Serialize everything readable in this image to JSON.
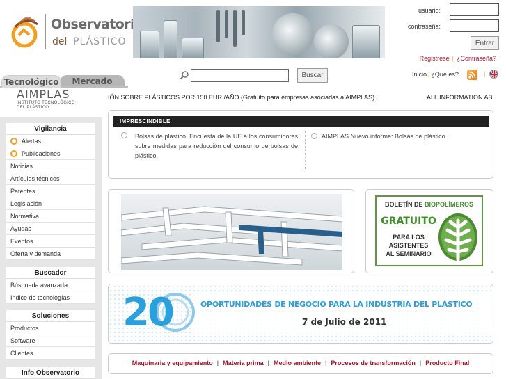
{
  "header": {
    "logo_title": "Observatorio",
    "logo_sub_del": "del",
    "logo_sub_plastico": "PLÁSTICO"
  },
  "login": {
    "user_label": "usuario:",
    "password_label": "contraseña:",
    "submit_label": "Entrar",
    "register_link": "Registrese",
    "separator": "|",
    "forgot_link": "¿Contraseña?"
  },
  "nav": {
    "tabs": [
      {
        "label": "Tecnológico"
      },
      {
        "label": "Mercado"
      }
    ],
    "search_button": "Buscar",
    "links": {
      "home": "Inicio",
      "about": "¿Qué es?",
      "separator": "|"
    }
  },
  "org": {
    "name": "AIMPLAS",
    "subtitle_line1": "INSTITUTO TECNOLÓGICO",
    "subtitle_line2": "DEL PLÁSTICO"
  },
  "sidebar": {
    "vigilancia": {
      "title": "Vigilancia",
      "items": [
        {
          "label": "Alertas"
        },
        {
          "label": "Publicaciones"
        },
        {
          "label": "Noticias"
        },
        {
          "label": "Artículos técnicos"
        },
        {
          "label": "Patentes"
        },
        {
          "label": "Legislación"
        },
        {
          "label": "Normativa"
        },
        {
          "label": "Ayudas"
        },
        {
          "label": "Eventos"
        },
        {
          "label": "Oferta y demanda"
        }
      ]
    },
    "buscador": {
      "title": "Buscador",
      "items": [
        {
          "label": "Búsqueda avanzada"
        },
        {
          "label": "Indice de tecnologías"
        }
      ]
    },
    "soluciones": {
      "title": "Soluciones",
      "items": [
        {
          "label": "Productos"
        },
        {
          "label": "Software"
        },
        {
          "label": "Clientes"
        }
      ]
    },
    "info": {
      "title": "Info Observatorio"
    }
  },
  "ticker": {
    "text1": "IÓN SOBRE PLÁSTICOS POR 150 EUR /AÑO (Gratuito para empresas asociadas a AIMPLAS).",
    "text2": "ALL INFORMATION AB"
  },
  "imprescindible": {
    "title": "IMPRESCINDIBLE",
    "items": [
      {
        "text": "Bolsas de plástico. Encuesta de la UE a los consumidores sobre medidas para reducción del consumo de bolsas de plástico."
      },
      {
        "text": "AIMPLAS Nuevo informe: Bolsas de plástico."
      }
    ]
  },
  "biopolimeros": {
    "title_prefix": "BOLETÍN DE ",
    "title_highlight": "BIOPOLÍMEROS",
    "gratuito": "GRATUITO",
    "line1": "PARA LOS",
    "line2": "ASISTENTES",
    "line3": "AL SEMINARIO",
    "highlight_color": "#3f8f28"
  },
  "oportunidades": {
    "number": "20",
    "title": "OPORTUNIDADES DE NEGOCIO PARA LA INDUSTRIA DEL PLÁSTICO",
    "date": "7 de Julio de 2011",
    "accent_color": "#2aa0dc"
  },
  "categories": {
    "links": [
      {
        "label": "Maquinaria y equipamiento"
      },
      {
        "label": "Materia prima"
      },
      {
        "label": "Medio ambiente"
      },
      {
        "label": "Procesos de transformación"
      },
      {
        "label": "Producto Final"
      }
    ],
    "separator": "|",
    "link_color": "#a8142a"
  },
  "icons": {
    "search": "magnifier-icon",
    "rss": "rss-icon",
    "language": "uk-flag-icon",
    "bullet": "orange-ring-icon",
    "news": "clock-icon"
  }
}
